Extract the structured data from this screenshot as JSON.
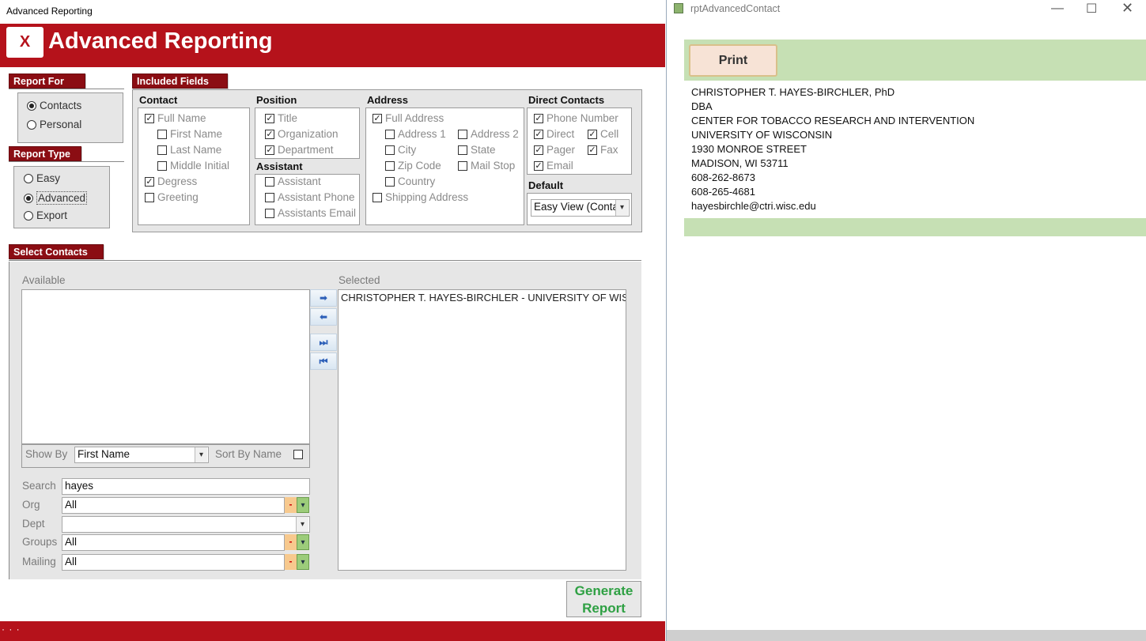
{
  "left_window": {
    "title": "Advanced Reporting",
    "close_label": "X",
    "app_title": "Advanced Reporting",
    "report_for": {
      "tab": "Report For",
      "options": [
        {
          "label": "Contacts",
          "selected": true
        },
        {
          "label": "Personal",
          "selected": false
        }
      ]
    },
    "report_type": {
      "tab": "Report Type",
      "options": [
        {
          "label": "Easy",
          "selected": false
        },
        {
          "label": "Advanced",
          "selected": true
        },
        {
          "label": "Export",
          "selected": false
        }
      ]
    },
    "included_fields": {
      "tab": "Included Fields",
      "contact": {
        "heading": "Contact",
        "items": [
          {
            "label": "Full Name",
            "checked": true
          },
          {
            "label": "First Name",
            "checked": false
          },
          {
            "label": "Last Name",
            "checked": false
          },
          {
            "label": "Middle Initial",
            "checked": false
          },
          {
            "label": "Degress",
            "checked": true
          },
          {
            "label": "Greeting",
            "checked": false
          }
        ]
      },
      "position": {
        "heading": "Position",
        "items": [
          {
            "label": "Title",
            "checked": true
          },
          {
            "label": "Organization",
            "checked": true
          },
          {
            "label": "Department",
            "checked": true
          }
        ]
      },
      "assistant": {
        "heading": "Assistant",
        "items": [
          {
            "label": "Assistant",
            "checked": false
          },
          {
            "label": "Assistant Phone",
            "checked": false
          },
          {
            "label": "Assistants Email",
            "checked": false
          }
        ]
      },
      "address": {
        "heading": "Address",
        "items": [
          {
            "label": "Full Address",
            "checked": true
          },
          {
            "label": "Address 1",
            "checked": false
          },
          {
            "label": "Address 2",
            "checked": false
          },
          {
            "label": "City",
            "checked": false
          },
          {
            "label": "State",
            "checked": false
          },
          {
            "label": "Zip Code",
            "checked": false
          },
          {
            "label": "Mail Stop",
            "checked": false
          },
          {
            "label": "Country",
            "checked": false
          },
          {
            "label": "Shipping Address",
            "checked": false
          }
        ]
      },
      "direct_contacts": {
        "heading": "Direct Contacts",
        "items": [
          {
            "label": "Phone Number",
            "checked": true
          },
          {
            "label": "Direct",
            "checked": true
          },
          {
            "label": "Cell",
            "checked": true
          },
          {
            "label": "Pager",
            "checked": true
          },
          {
            "label": "Fax",
            "checked": true
          },
          {
            "label": "Email",
            "checked": true
          }
        ]
      },
      "default": {
        "heading": "Default",
        "value": "Easy View (Conta"
      }
    },
    "select_contacts": {
      "tab": "Select Contacts",
      "available_label": "Available",
      "selected_label": "Selected",
      "selected_items": [
        "CHRISTOPHER T. HAYES-BIRCHLER - UNIVERSITY OF WISCON"
      ],
      "show_by_label": "Show By",
      "show_by_value": "First Name",
      "sort_by_label": "Sort By Name",
      "sort_by_checked": false,
      "filters": {
        "search_label": "Search",
        "search_value": "hayes",
        "org_label": "Org",
        "org_value": "All",
        "dept_label": "Dept",
        "dept_value": "",
        "groups_label": "Groups",
        "groups_value": "All",
        "mailing_label": "Mailing",
        "mailing_value": "All"
      },
      "move_buttons": [
        "move-right",
        "move-left",
        "move-all-right",
        "move-all-left"
      ]
    },
    "generate_button": {
      "line1": "Generate",
      "line2": "Report"
    },
    "status_bar": "· · ·"
  },
  "right_window": {
    "title": "rptAdvancedContact",
    "print_label": "Print",
    "report_lines": [
      "CHRISTOPHER T. HAYES-BIRCHLER, PhD",
      "DBA",
      "CENTER FOR TOBACCO RESEARCH AND INTERVENTION",
      "UNIVERSITY OF WISCONSIN",
      "1930 MONROE STREET",
      "MADISON, WI 53711",
      "608-262-8673",
      "608-265-4681",
      "hayesbirchle@ctri.wisc.edu"
    ],
    "band_color": "#c6e0b4"
  },
  "colors": {
    "brand_red": "#b5121b",
    "tab_red": "#8b0d13",
    "generate_green": "#2ea043"
  }
}
